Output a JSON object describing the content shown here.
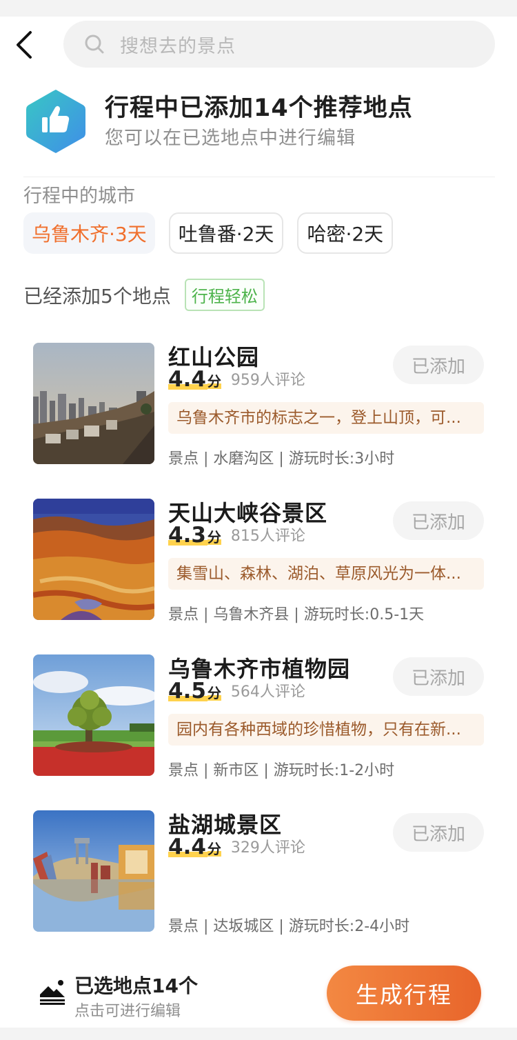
{
  "search": {
    "placeholder": "搜想去的景点"
  },
  "banner": {
    "title": "行程中已添加14个推荐地点",
    "subtitle": "您可以在已选地点中进行编辑",
    "icon": "thumbs-up-hexagon-icon"
  },
  "cities": {
    "label": "行程中的城市",
    "items": [
      {
        "label": "乌鲁木齐·3天",
        "active": true
      },
      {
        "label": "吐鲁番·2天",
        "active": false
      },
      {
        "label": "哈密·2天",
        "active": false
      }
    ]
  },
  "added": {
    "text": "已经添加5个地点",
    "tag": "行程轻松"
  },
  "places": [
    {
      "name": "红山公园",
      "score": "4.4",
      "unit": "分",
      "reviews": "959人评论",
      "desc": "乌鲁木齐市的标志之一，登上山顶，可...",
      "meta": "景点 | 水磨沟区 | 游玩时长:3小时",
      "button": "已添加"
    },
    {
      "name": "天山大峡谷景区",
      "score": "4.3",
      "unit": "分",
      "reviews": "815人评论",
      "desc": "集雪山、森林、湖泊、草原风光为一体...",
      "meta": "景点 | 乌鲁木齐县 | 游玩时长:0.5-1天",
      "button": "已添加"
    },
    {
      "name": "乌鲁木齐市植物园",
      "score": "4.5",
      "unit": "分",
      "reviews": "564人评论",
      "desc": "园内有各种西域的珍惜植物，只有在新...",
      "meta": "景点 | 新市区 | 游玩时长:1-2小时",
      "button": "已添加"
    },
    {
      "name": "盐湖城景区",
      "score": "4.4",
      "unit": "分",
      "reviews": "329人评论",
      "desc": "",
      "meta": "景点 | 达坂城区 | 游玩时长:2-4小时",
      "button": "已添加"
    }
  ],
  "footer": {
    "selected": "已选地点14个",
    "hint": "点击可进行编辑",
    "generate": "生成行程",
    "icon": "mountain-sun-icon"
  },
  "colors": {
    "accent": "#f06f2c",
    "button_gradient": [
      "#f38842",
      "#e8652b"
    ],
    "tag_green": "#4db34b"
  }
}
